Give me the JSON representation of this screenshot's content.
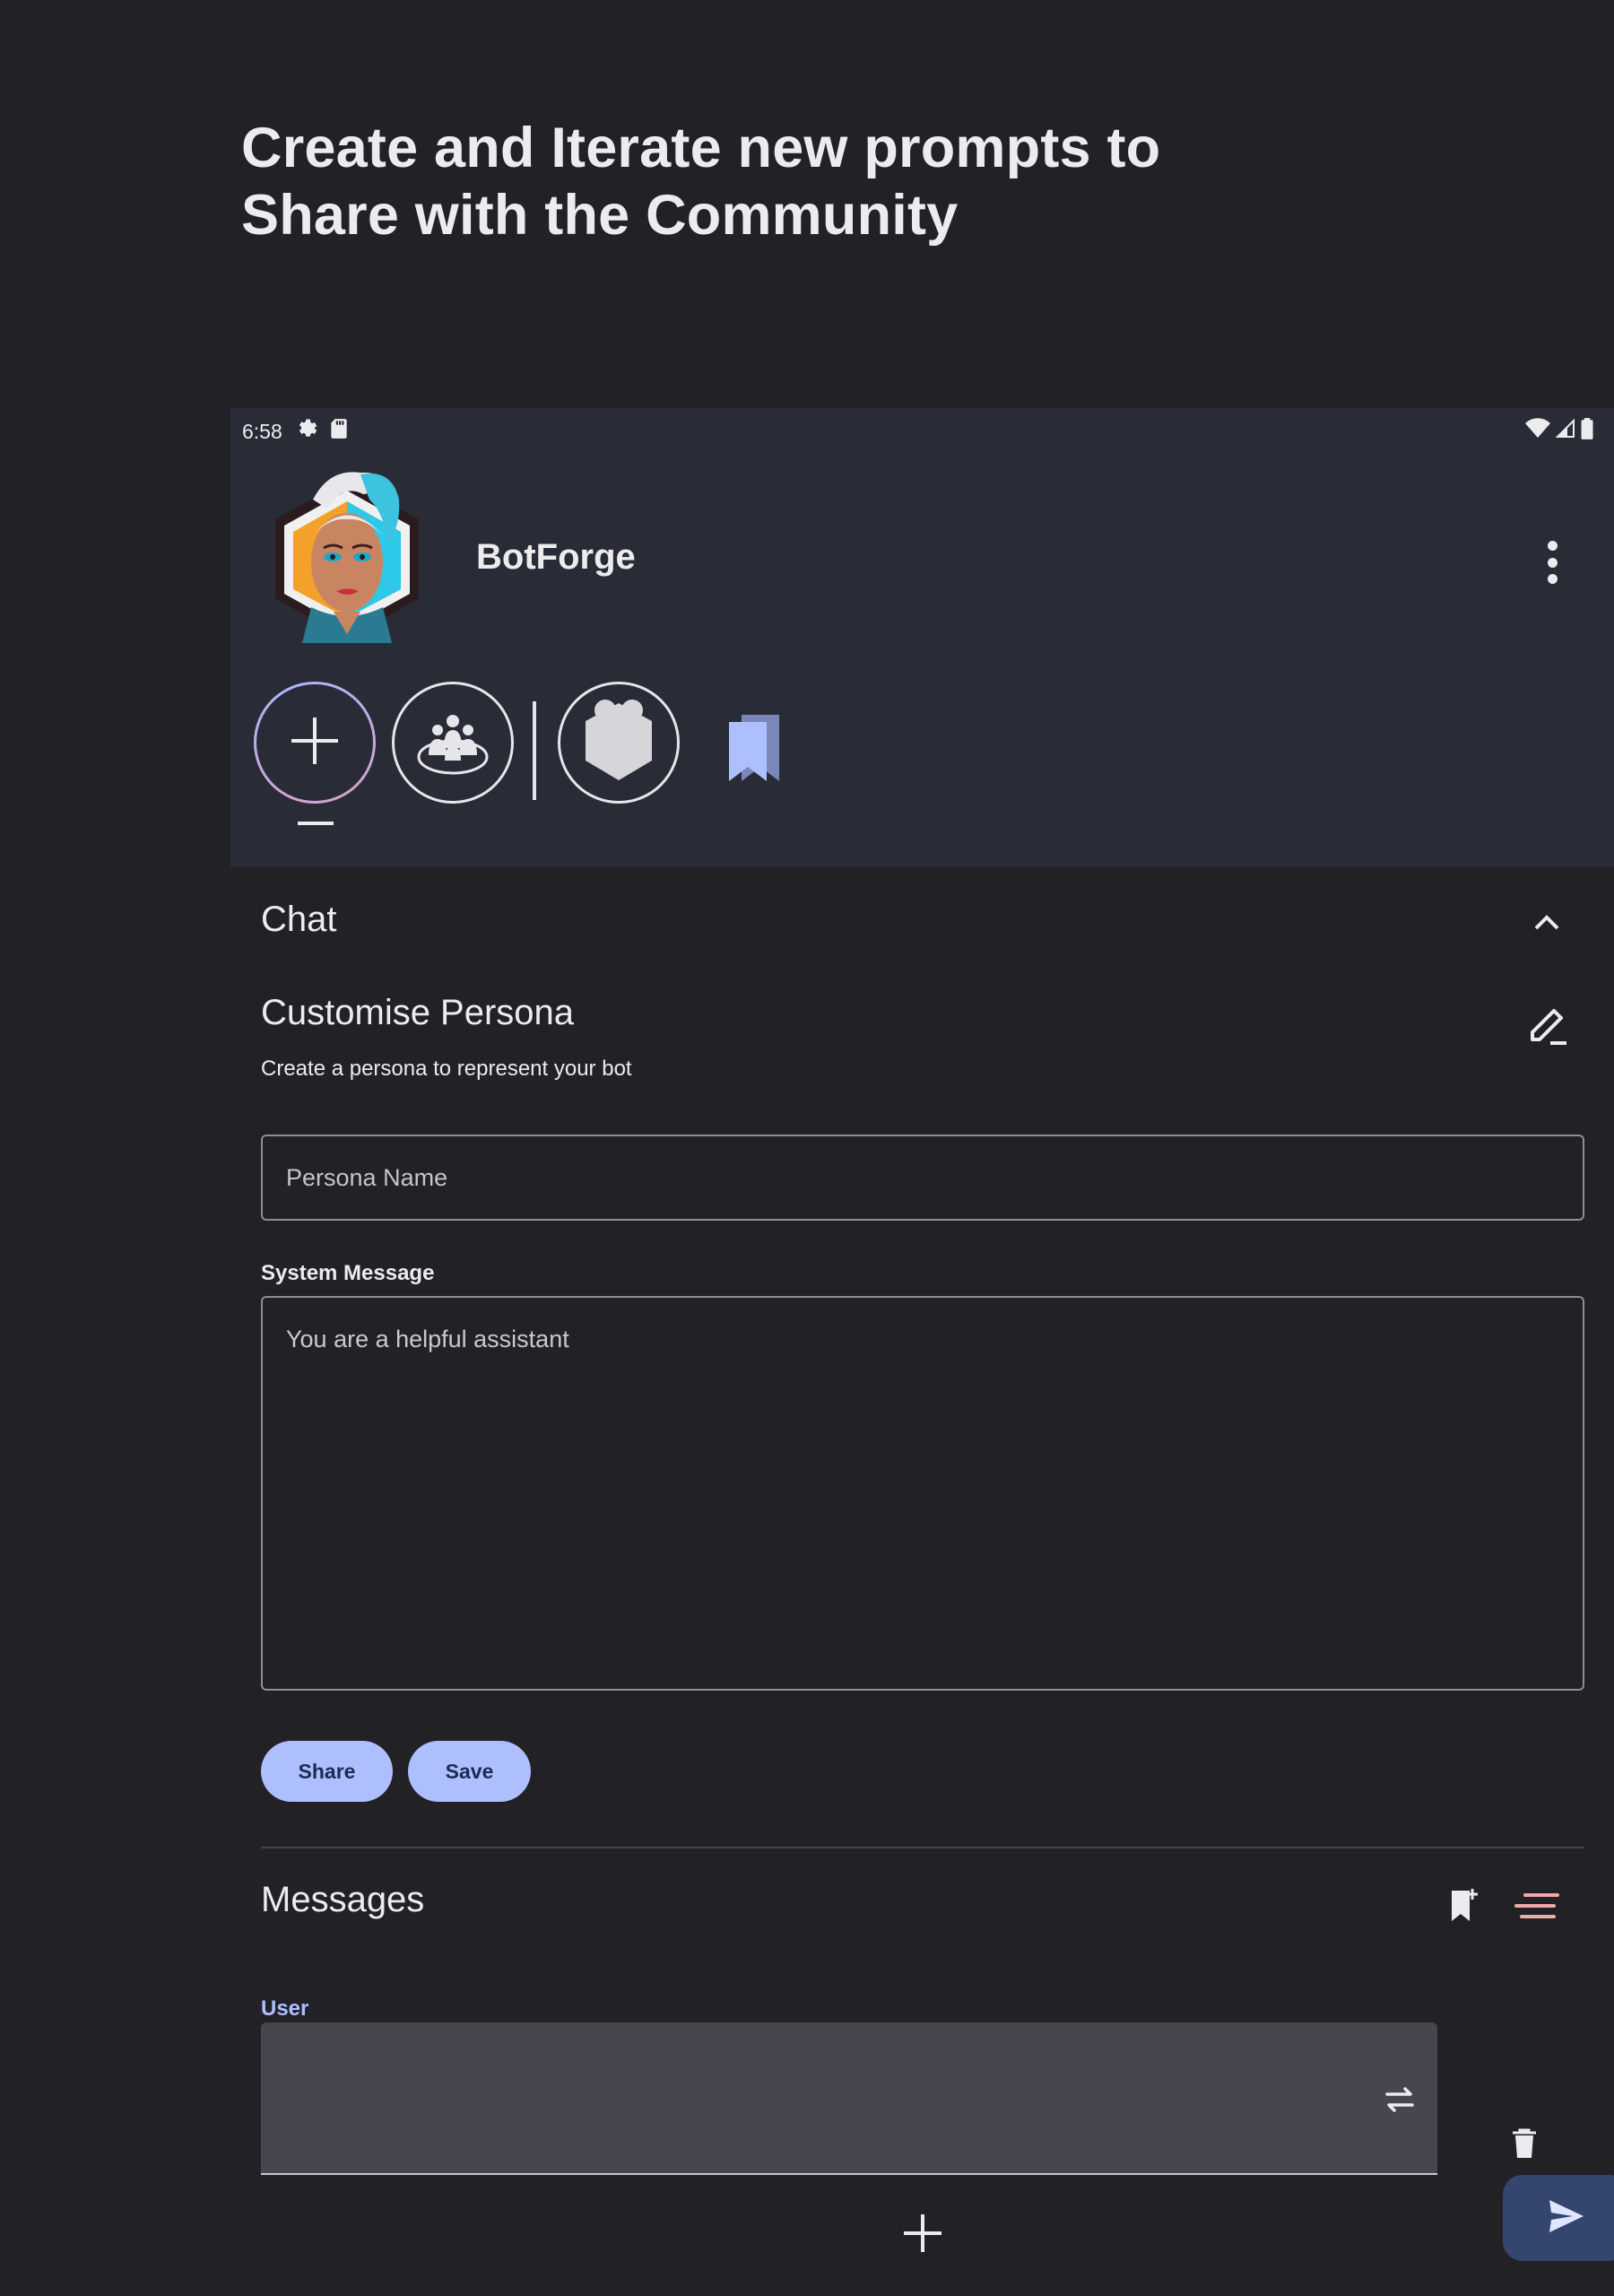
{
  "headline": {
    "line1": "Create and Iterate new prompts to",
    "line2": "Share with the Community"
  },
  "status_bar": {
    "time": "6:58",
    "icons": [
      "gear-icon",
      "sd-card-icon",
      "wifi-icon",
      "signal-icon",
      "battery-icon"
    ]
  },
  "app": {
    "name": "BotForge",
    "menu_icon": "more-vertical-icon"
  },
  "tabs": [
    {
      "icon": "plus-icon",
      "selected": true
    },
    {
      "icon": "community-icon",
      "selected": false
    },
    {
      "icon": "persona-hexagon-icon",
      "selected": false
    },
    {
      "icon": "bookmarks-icon",
      "selected": false
    }
  ],
  "chat_section": {
    "title": "Chat",
    "toggle_icon": "chevron-up-icon"
  },
  "persona": {
    "title": "Customise Persona",
    "subtitle": "Create a persona to represent your bot",
    "edit_icon": "edit-pencil-icon",
    "name_placeholder": "Persona Name",
    "system_message_label": "System Message",
    "system_message_value": "You are a helpful assistant"
  },
  "buttons": {
    "share": "Share",
    "save": "Save"
  },
  "messages": {
    "title": "Messages",
    "role_label": "User",
    "message_value": "",
    "icons": [
      "bookmark-add-icon",
      "sort-lines-icon",
      "swap-icon",
      "delete-icon",
      "add-icon",
      "send-icon"
    ]
  },
  "colors": {
    "background": "#212126",
    "topbar": "#292c36",
    "accent": "#aebfff",
    "message_box": "#46464e",
    "fab": "#35466e",
    "sort_icon": "#f0a8a8"
  }
}
